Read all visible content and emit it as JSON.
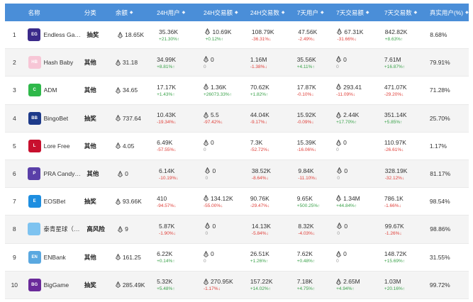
{
  "header": {
    "index": "",
    "name": "名称",
    "category": "分类",
    "balance": "余额",
    "users_24h": "24H用户",
    "tx_24h": "24H交易额",
    "count_24h": "24H交易数",
    "users_7d": "7天用户",
    "tx_7d": "7天交易额",
    "count_7d": "7天交易数",
    "real_users": "真实用户(%)",
    "sort_glyph": "◆"
  },
  "rows": [
    {
      "idx": "1",
      "name": "Endless Game",
      "logo_text": "EG",
      "logo_color": "#3b2a8a",
      "category": "抽奖",
      "balance": "18.65K",
      "u24": "35.36K",
      "u24c": "+21.30%",
      "u24d": "up",
      "t24": "10.69K",
      "t24c": "+0.12%",
      "t24d": "up",
      "n24": "108.79K",
      "n24c": "-36.31%",
      "n24d": "dn",
      "u7": "47.56K",
      "u7c": "-2.49%",
      "u7d": "dn",
      "t7": "67.31K",
      "t7c": "-31.66%",
      "t7d": "dn",
      "n7": "842.82K",
      "n7c": "+8.63%",
      "n7d": "up",
      "real": "8.68%"
    },
    {
      "idx": "2",
      "name": "Hash Baby",
      "logo_text": "HB",
      "logo_color": "#f7c6d6",
      "category": "其他",
      "balance": "31.18",
      "u24": "34.99K",
      "u24c": "+8.81%",
      "u24d": "up",
      "t24": "0",
      "t24c": "0",
      "t24d": "neu",
      "n24": "1.16M",
      "n24c": "-1.38%",
      "n24d": "dn",
      "u7": "35.56K",
      "u7c": "+4.11%",
      "u7d": "up",
      "t7": "0",
      "t7c": "0",
      "t7d": "neu",
      "n7": "7.61M",
      "n7c": "+16.87%",
      "n7d": "up",
      "real": "79.91%"
    },
    {
      "idx": "3",
      "name": "ADM",
      "logo_text": "C",
      "logo_color": "#2fb84a",
      "category": "其他",
      "balance": "34.65",
      "u24": "17.17K",
      "u24c": "+1.43%",
      "u24d": "up",
      "t24": "1.36K",
      "t24c": "+26073.33%",
      "t24d": "up",
      "n24": "70.62K",
      "n24c": "+1.82%",
      "n24d": "up",
      "u7": "17.87K",
      "u7c": "-0.10%",
      "u7d": "dn",
      "t7": "293.41",
      "t7c": "-11.09%",
      "t7d": "dn",
      "n7": "471.07K",
      "n7c": "-29.20%",
      "n7d": "dn",
      "real": "71.28%"
    },
    {
      "idx": "4",
      "name": "BingoBet",
      "logo_text": "BB",
      "logo_color": "#1d3a8a",
      "category": "抽奖",
      "balance": "737.64",
      "u24": "10.43K",
      "u24c": "-19.34%",
      "u24d": "dn",
      "t24": "5.5",
      "t24c": "-97.42%",
      "t24d": "dn",
      "n24": "44.04K",
      "n24c": "-9.17%",
      "n24d": "dn",
      "u7": "15.92K",
      "u7c": "-0.09%",
      "u7d": "dn",
      "t7": "2.44K",
      "t7c": "+17.70%",
      "t7d": "up",
      "n7": "351.14K",
      "n7c": "+5.85%",
      "n7d": "up",
      "real": "25.70%"
    },
    {
      "idx": "5",
      "name": "Lore Free",
      "logo_text": "L",
      "logo_color": "#c8102e",
      "category": "其他",
      "balance": "4.05",
      "u24": "6.49K",
      "u24c": "-57.55%",
      "u24d": "dn",
      "t24": "0",
      "t24c": "0",
      "t24d": "neu",
      "n24": "7.3K",
      "n24c": "-52.72%",
      "n24d": "dn",
      "u7": "15.39K",
      "u7c": "-16.06%",
      "u7d": "dn",
      "t7": "0",
      "t7c": "0",
      "t7d": "neu",
      "n7": "110.97K",
      "n7c": "-26.61%",
      "n7d": "dn",
      "real": "1.17%"
    },
    {
      "idx": "6",
      "name": "PRA CandyBox",
      "logo_text": "P",
      "logo_color": "#5a3fa8",
      "category": "其他",
      "balance": "0",
      "u24": "6.14K",
      "u24c": "-10.19%",
      "u24d": "dn",
      "t24": "0",
      "t24c": "0",
      "t24d": "neu",
      "n24": "38.52K",
      "n24c": "-8.64%",
      "n24d": "dn",
      "u7": "9.84K",
      "u7c": "-11.10%",
      "u7d": "dn",
      "t7": "0",
      "t7c": "0",
      "t7d": "neu",
      "n7": "328.19K",
      "n7c": "-32.12%",
      "n7d": "dn",
      "real": "81.17%"
    },
    {
      "idx": "7",
      "name": "EOSBet",
      "logo_text": "E",
      "logo_color": "#1e8ee0",
      "category": "抽奖",
      "balance": "93.66K",
      "u24": "410",
      "u24c": "-94.57%",
      "u24d": "dn",
      "t24": "134.12K",
      "t24c": "-55.00%",
      "t24d": "dn",
      "n24": "90.76K",
      "n24c": "-29.47%",
      "n24d": "dn",
      "u7": "9.65K",
      "u7c": "+500.25%",
      "u7d": "up",
      "t7": "1.34M",
      "t7c": "+44.84%",
      "t7d": "up",
      "n7": "786.1K",
      "n7c": "-1.66%",
      "n7d": "dn",
      "real": "98.54%"
    },
    {
      "idx": "8",
      "name": "泰青星球（To...",
      "logo_text": "",
      "logo_color": "#7ec3f0",
      "category": "高风险",
      "balance": "9",
      "u24": "5.87K",
      "u24c": "-1.90%",
      "u24d": "dn",
      "t24": "0",
      "t24c": "0",
      "t24d": "neu",
      "n24": "14.13K",
      "n24c": "-5.84%",
      "n24d": "dn",
      "u7": "8.32K",
      "u7c": "-4.03%",
      "u7d": "dn",
      "t7": "0",
      "t7c": "0",
      "t7d": "neu",
      "n7": "99.67K",
      "n7c": "-1.26%",
      "n7d": "dn",
      "real": "98.86%"
    },
    {
      "idx": "9",
      "name": "ENBank",
      "logo_text": "EN",
      "logo_color": "#5aa8e0",
      "category": "其他",
      "balance": "161.25",
      "u24": "6.22K",
      "u24c": "+0.14%",
      "u24d": "up",
      "t24": "0",
      "t24c": "0",
      "t24d": "neu",
      "n24": "26.51K",
      "n24c": "+1.26%",
      "n24d": "up",
      "u7": "7.62K",
      "u7c": "+0.48%",
      "u7d": "up",
      "t7": "0",
      "t7c": "0",
      "t7d": "neu",
      "n7": "148.72K",
      "n7c": "+15.69%",
      "n7d": "up",
      "real": "31.55%"
    },
    {
      "idx": "10",
      "name": "BigGame",
      "logo_text": "BG",
      "logo_color": "#6a2a9a",
      "category": "抽奖",
      "balance": "285.49K",
      "u24": "5.32K",
      "u24c": "+5.48%",
      "u24d": "up",
      "t24": "270.95K",
      "t24c": "-1.17%",
      "t24d": "dn",
      "n24": "157.22K",
      "n24c": "+14.02%",
      "n24d": "up",
      "u7": "7.18K",
      "u7c": "+4.75%",
      "u7d": "up",
      "t7": "2.65M",
      "t7c": "+4.94%",
      "t7d": "up",
      "n7": "1.03M",
      "n7c": "+20.16%",
      "n7d": "up",
      "real": "99.72%"
    }
  ],
  "arrows": {
    "up": "↑",
    "dn": "↓",
    "neu": ""
  },
  "colors": {
    "header_bg": "#4a8ed8",
    "up": "#3aa24a",
    "down": "#e0403a",
    "alt_row": "#f4f4f4"
  },
  "icons": {
    "currency": "eos-icon",
    "sort": "sort-icon"
  }
}
